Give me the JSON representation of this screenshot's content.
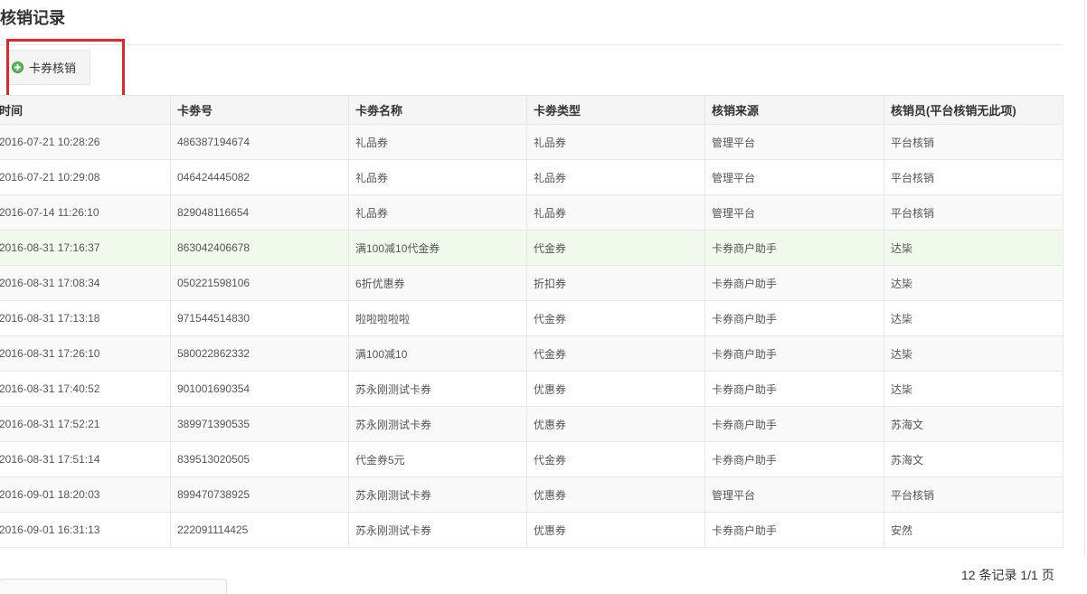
{
  "page": {
    "title": "核销记录"
  },
  "toolbar": {
    "verify_button_label": "卡券核销",
    "verify_button_icon": "plus-circle-icon",
    "icon_color": "#5cb85c"
  },
  "annotation": {
    "color": "#e8232a"
  },
  "table": {
    "columns": [
      "时间",
      "卡劵号",
      "卡劵名称",
      "卡劵类型",
      "核销来源",
      "核销员(平台核销无此项)"
    ],
    "highlighted_row": 3,
    "rows": [
      {
        "time": "2016-07-21 10:28:26",
        "card_no": "486387194674",
        "card_name": "礼品券",
        "card_type": "礼品券",
        "source": "管理平台",
        "operator": "平台核销"
      },
      {
        "time": "2016-07-21 10:29:08",
        "card_no": "046424445082",
        "card_name": "礼品券",
        "card_type": "礼品券",
        "source": "管理平台",
        "operator": "平台核销"
      },
      {
        "time": "2016-07-14 11:26:10",
        "card_no": "829048116654",
        "card_name": "礼品券",
        "card_type": "礼品券",
        "source": "管理平台",
        "operator": "平台核销"
      },
      {
        "time": "2016-08-31 17:16:37",
        "card_no": "863042406678",
        "card_name": "满100减10代金券",
        "card_type": "代金券",
        "source": "卡券商户助手",
        "operator": "达枈"
      },
      {
        "time": "2016-08-31 17:08:34",
        "card_no": "050221598106",
        "card_name": "6折优惠券",
        "card_type": "折扣券",
        "source": "卡券商户助手",
        "operator": "达枈"
      },
      {
        "time": "2016-08-31 17:13:18",
        "card_no": "971544514830",
        "card_name": "啦啦啦啦啦",
        "card_type": "代金券",
        "source": "卡券商户助手",
        "operator": "达枈"
      },
      {
        "time": "2016-08-31 17:26:10",
        "card_no": "580022862332",
        "card_name": "满100减10",
        "card_type": "代金券",
        "source": "卡券商户助手",
        "operator": "达枈"
      },
      {
        "time": "2016-08-31 17:40:52",
        "card_no": "901001690354",
        "card_name": "苏永刚测试卡券",
        "card_type": "优惠券",
        "source": "卡券商户助手",
        "operator": "达枈"
      },
      {
        "time": "2016-08-31 17:52:21",
        "card_no": "389971390535",
        "card_name": "苏永刚测试卡券",
        "card_type": "优惠券",
        "source": "卡券商户助手",
        "operator": "苏海文"
      },
      {
        "time": "2016-08-31 17:51:14",
        "card_no": "839513020505",
        "card_name": "代金券5元",
        "card_type": "代金券",
        "source": "卡券商户助手",
        "operator": "苏海文"
      },
      {
        "time": "2016-09-01 18:20:03",
        "card_no": "899470738925",
        "card_name": "苏永刚测试卡券",
        "card_type": "优惠券",
        "source": "管理平台",
        "operator": "平台核销"
      },
      {
        "time": "2016-09-01 16:31:13",
        "card_no": "222091114425",
        "card_name": "苏永刚测试卡券",
        "card_type": "优惠券",
        "source": "卡券商户助手",
        "operator": "安然"
      }
    ]
  },
  "pagination": {
    "summary": "12 条记录 1/1 页"
  }
}
